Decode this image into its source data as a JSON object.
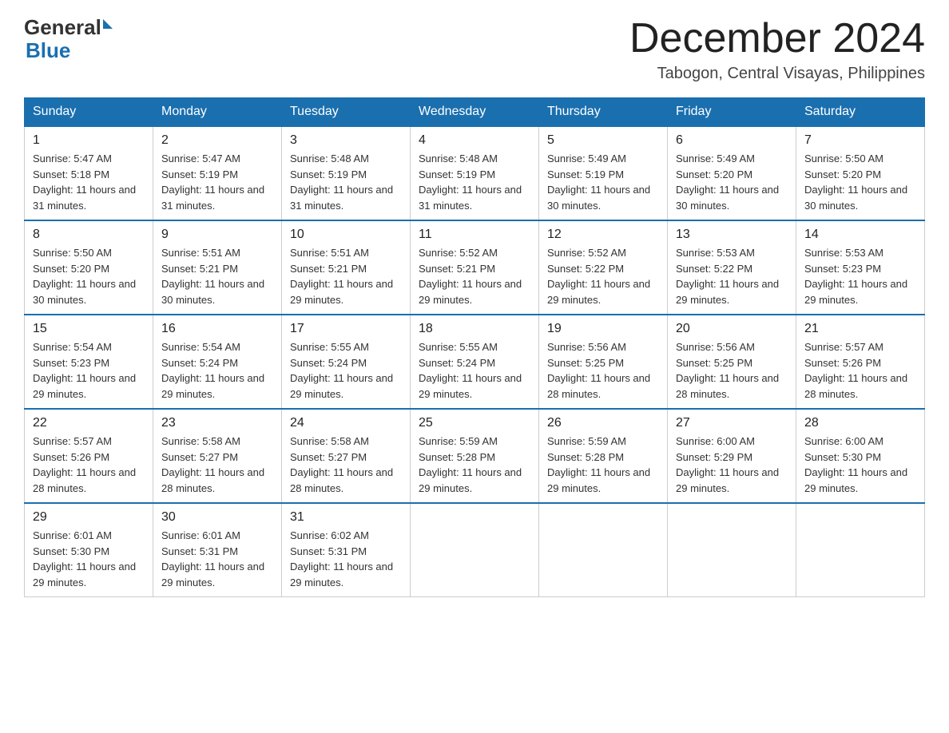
{
  "header": {
    "logo_general": "General",
    "logo_blue": "Blue",
    "month_title": "December 2024",
    "location": "Tabogon, Central Visayas, Philippines"
  },
  "days_of_week": [
    "Sunday",
    "Monday",
    "Tuesday",
    "Wednesday",
    "Thursday",
    "Friday",
    "Saturday"
  ],
  "weeks": [
    [
      {
        "day": "1",
        "sunrise": "Sunrise: 5:47 AM",
        "sunset": "Sunset: 5:18 PM",
        "daylight": "Daylight: 11 hours and 31 minutes."
      },
      {
        "day": "2",
        "sunrise": "Sunrise: 5:47 AM",
        "sunset": "Sunset: 5:19 PM",
        "daylight": "Daylight: 11 hours and 31 minutes."
      },
      {
        "day": "3",
        "sunrise": "Sunrise: 5:48 AM",
        "sunset": "Sunset: 5:19 PM",
        "daylight": "Daylight: 11 hours and 31 minutes."
      },
      {
        "day": "4",
        "sunrise": "Sunrise: 5:48 AM",
        "sunset": "Sunset: 5:19 PM",
        "daylight": "Daylight: 11 hours and 31 minutes."
      },
      {
        "day": "5",
        "sunrise": "Sunrise: 5:49 AM",
        "sunset": "Sunset: 5:19 PM",
        "daylight": "Daylight: 11 hours and 30 minutes."
      },
      {
        "day": "6",
        "sunrise": "Sunrise: 5:49 AM",
        "sunset": "Sunset: 5:20 PM",
        "daylight": "Daylight: 11 hours and 30 minutes."
      },
      {
        "day": "7",
        "sunrise": "Sunrise: 5:50 AM",
        "sunset": "Sunset: 5:20 PM",
        "daylight": "Daylight: 11 hours and 30 minutes."
      }
    ],
    [
      {
        "day": "8",
        "sunrise": "Sunrise: 5:50 AM",
        "sunset": "Sunset: 5:20 PM",
        "daylight": "Daylight: 11 hours and 30 minutes."
      },
      {
        "day": "9",
        "sunrise": "Sunrise: 5:51 AM",
        "sunset": "Sunset: 5:21 PM",
        "daylight": "Daylight: 11 hours and 30 minutes."
      },
      {
        "day": "10",
        "sunrise": "Sunrise: 5:51 AM",
        "sunset": "Sunset: 5:21 PM",
        "daylight": "Daylight: 11 hours and 29 minutes."
      },
      {
        "day": "11",
        "sunrise": "Sunrise: 5:52 AM",
        "sunset": "Sunset: 5:21 PM",
        "daylight": "Daylight: 11 hours and 29 minutes."
      },
      {
        "day": "12",
        "sunrise": "Sunrise: 5:52 AM",
        "sunset": "Sunset: 5:22 PM",
        "daylight": "Daylight: 11 hours and 29 minutes."
      },
      {
        "day": "13",
        "sunrise": "Sunrise: 5:53 AM",
        "sunset": "Sunset: 5:22 PM",
        "daylight": "Daylight: 11 hours and 29 minutes."
      },
      {
        "day": "14",
        "sunrise": "Sunrise: 5:53 AM",
        "sunset": "Sunset: 5:23 PM",
        "daylight": "Daylight: 11 hours and 29 minutes."
      }
    ],
    [
      {
        "day": "15",
        "sunrise": "Sunrise: 5:54 AM",
        "sunset": "Sunset: 5:23 PM",
        "daylight": "Daylight: 11 hours and 29 minutes."
      },
      {
        "day": "16",
        "sunrise": "Sunrise: 5:54 AM",
        "sunset": "Sunset: 5:24 PM",
        "daylight": "Daylight: 11 hours and 29 minutes."
      },
      {
        "day": "17",
        "sunrise": "Sunrise: 5:55 AM",
        "sunset": "Sunset: 5:24 PM",
        "daylight": "Daylight: 11 hours and 29 minutes."
      },
      {
        "day": "18",
        "sunrise": "Sunrise: 5:55 AM",
        "sunset": "Sunset: 5:24 PM",
        "daylight": "Daylight: 11 hours and 29 minutes."
      },
      {
        "day": "19",
        "sunrise": "Sunrise: 5:56 AM",
        "sunset": "Sunset: 5:25 PM",
        "daylight": "Daylight: 11 hours and 28 minutes."
      },
      {
        "day": "20",
        "sunrise": "Sunrise: 5:56 AM",
        "sunset": "Sunset: 5:25 PM",
        "daylight": "Daylight: 11 hours and 28 minutes."
      },
      {
        "day": "21",
        "sunrise": "Sunrise: 5:57 AM",
        "sunset": "Sunset: 5:26 PM",
        "daylight": "Daylight: 11 hours and 28 minutes."
      }
    ],
    [
      {
        "day": "22",
        "sunrise": "Sunrise: 5:57 AM",
        "sunset": "Sunset: 5:26 PM",
        "daylight": "Daylight: 11 hours and 28 minutes."
      },
      {
        "day": "23",
        "sunrise": "Sunrise: 5:58 AM",
        "sunset": "Sunset: 5:27 PM",
        "daylight": "Daylight: 11 hours and 28 minutes."
      },
      {
        "day": "24",
        "sunrise": "Sunrise: 5:58 AM",
        "sunset": "Sunset: 5:27 PM",
        "daylight": "Daylight: 11 hours and 28 minutes."
      },
      {
        "day": "25",
        "sunrise": "Sunrise: 5:59 AM",
        "sunset": "Sunset: 5:28 PM",
        "daylight": "Daylight: 11 hours and 29 minutes."
      },
      {
        "day": "26",
        "sunrise": "Sunrise: 5:59 AM",
        "sunset": "Sunset: 5:28 PM",
        "daylight": "Daylight: 11 hours and 29 minutes."
      },
      {
        "day": "27",
        "sunrise": "Sunrise: 6:00 AM",
        "sunset": "Sunset: 5:29 PM",
        "daylight": "Daylight: 11 hours and 29 minutes."
      },
      {
        "day": "28",
        "sunrise": "Sunrise: 6:00 AM",
        "sunset": "Sunset: 5:30 PM",
        "daylight": "Daylight: 11 hours and 29 minutes."
      }
    ],
    [
      {
        "day": "29",
        "sunrise": "Sunrise: 6:01 AM",
        "sunset": "Sunset: 5:30 PM",
        "daylight": "Daylight: 11 hours and 29 minutes."
      },
      {
        "day": "30",
        "sunrise": "Sunrise: 6:01 AM",
        "sunset": "Sunset: 5:31 PM",
        "daylight": "Daylight: 11 hours and 29 minutes."
      },
      {
        "day": "31",
        "sunrise": "Sunrise: 6:02 AM",
        "sunset": "Sunset: 5:31 PM",
        "daylight": "Daylight: 11 hours and 29 minutes."
      },
      null,
      null,
      null,
      null
    ]
  ]
}
